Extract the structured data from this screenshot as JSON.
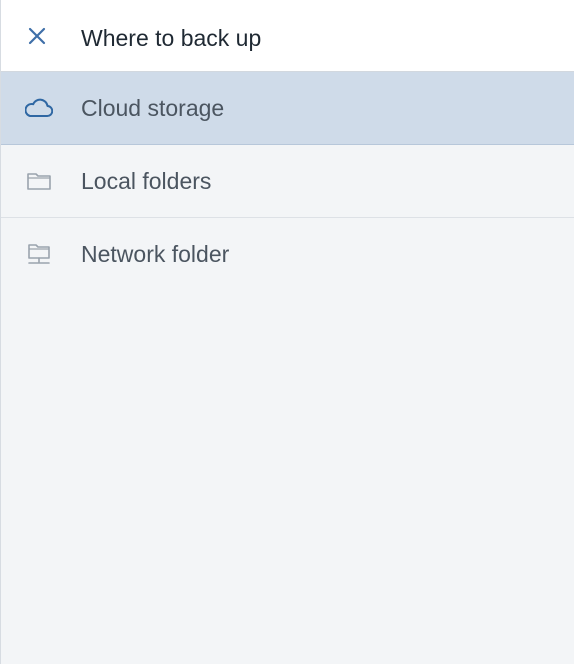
{
  "header": {
    "close_icon": "close-icon",
    "title": "Where to back up"
  },
  "colors": {
    "accent": "#3f6fa8",
    "selected_background": "#cfdbe9",
    "panel_background": "#f3f5f7",
    "muted_icon": "#9aa3ad"
  },
  "destinations": [
    {
      "label": "Cloud storage",
      "icon": "cloud-icon",
      "selected": true
    },
    {
      "label": "Local folders",
      "icon": "folder-icon",
      "selected": false
    },
    {
      "label": "Network folder",
      "icon": "network-folder-icon",
      "selected": false
    }
  ]
}
